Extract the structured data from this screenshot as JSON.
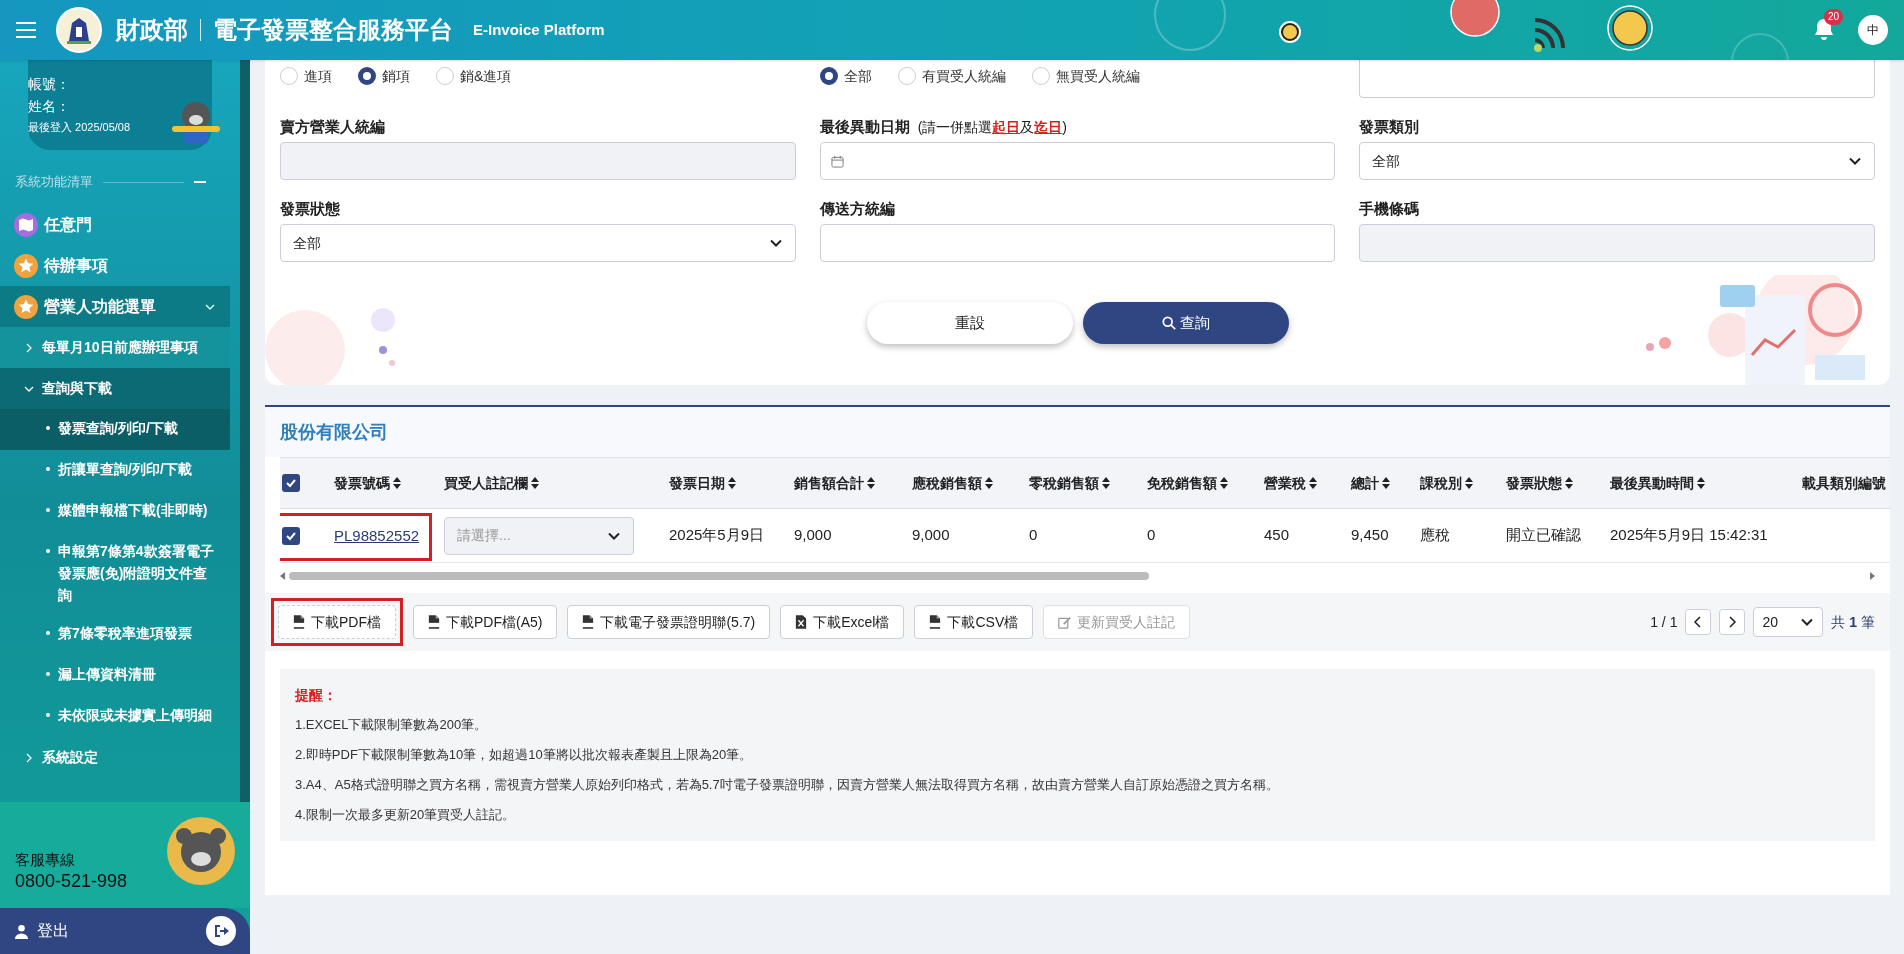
{
  "header": {
    "org": "財政部",
    "platform": "電子發票整合服務平台",
    "subtitle": "E-Invoice Platform",
    "notification_count": "20",
    "language": "中"
  },
  "user": {
    "account_label": "帳號：",
    "name_label": "姓名：",
    "last_login": "最後登入 2025/05/08"
  },
  "sidebar": {
    "section_title": "系統功能清單",
    "section_expanded": true,
    "items": [
      {
        "label": "任意門",
        "selected": false
      },
      {
        "label": "待辦事項",
        "selected": false
      },
      {
        "label": "營業人功能選單",
        "selected": false,
        "expanded": true,
        "children": [
          {
            "label": "每單月10日前應辦理事項",
            "selected": false,
            "expanded": false
          },
          {
            "label": "查詢與下載",
            "selected": false,
            "expanded": true,
            "children": [
              {
                "label": "發票查詢/列印/下載",
                "selected": true
              },
              {
                "label": "折讓單查詢/列印/下載",
                "selected": false
              },
              {
                "label": "媒體申報檔下載(非即時)",
                "selected": false
              },
              {
                "label": "申報第7條第4款簽署電子發票應(免)附證明文件查詢",
                "selected": false
              },
              {
                "label": "第7條零稅率進項發票",
                "selected": false
              },
              {
                "label": "漏上傳資料清冊",
                "selected": false
              },
              {
                "label": "未依限或未據實上傳明細",
                "selected": false
              }
            ]
          },
          {
            "label": "系統設定",
            "selected": false,
            "expanded": false
          }
        ]
      }
    ]
  },
  "support": {
    "label": "客服專線",
    "phone": "0800-521-998"
  },
  "logout": "登出",
  "search_form": {
    "rows": [
      [
        {
          "kind": "radio",
          "options": [
            {
              "label": "進項",
              "selected": false
            },
            {
              "label": "銷項",
              "selected": true
            },
            {
              "label": "銷&進項",
              "selected": false
            }
          ]
        },
        {
          "kind": "radio",
          "options": [
            {
              "label": "全部",
              "selected": true
            },
            {
              "label": "有買受人統編",
              "selected": false
            },
            {
              "label": "無買受人統編",
              "selected": false
            }
          ]
        },
        {
          "kind": "text",
          "disabled": false
        }
      ],
      [
        {
          "kind": "text",
          "label": "賣方營業人統編",
          "disabled": true
        },
        {
          "kind": "date",
          "label": "最後異動日期",
          "hint": "(請一併點選**起日**及**迄日**)",
          "disabled": false
        },
        {
          "kind": "select",
          "label": "發票類別",
          "value": "全部",
          "disabled": false
        }
      ],
      [
        {
          "kind": "select",
          "label": "發票狀態",
          "value": "全部",
          "disabled": false
        },
        {
          "kind": "text",
          "label": "傳送方統編",
          "disabled": false
        },
        {
          "kind": "text",
          "label": "手機條碼",
          "disabled": true
        }
      ]
    ],
    "reset_button": "重設",
    "search_button": "查詢"
  },
  "results": {
    "title": "股份有限公司",
    "all_checked": true,
    "columns": [
      {
        "label": "發票號碼",
        "sortable": true
      },
      {
        "label": "買受人註記欄",
        "sortable": true
      },
      {
        "label": "發票日期",
        "sortable": true
      },
      {
        "label": "銷售額合計",
        "sortable": true
      },
      {
        "label": "應稅銷售額",
        "sortable": true
      },
      {
        "label": "零稅銷售額",
        "sortable": true
      },
      {
        "label": "免稅銷售額",
        "sortable": true
      },
      {
        "label": "營業稅",
        "sortable": true
      },
      {
        "label": "總計",
        "sortable": true
      },
      {
        "label": "課稅別",
        "sortable": true
      },
      {
        "label": "發票狀態",
        "sortable": true
      },
      {
        "label": "最後異動時間",
        "sortable": true
      },
      {
        "label": "載具類別編號"
      }
    ],
    "rows": [
      {
        "checked": true,
        "highlighted": true,
        "invoice_number": "PL98852552",
        "buyer_note_placeholder": "請選擇...",
        "values": [
          "2025年5月9日",
          "9,000",
          "9,000",
          "0",
          "0",
          "450",
          "9,450",
          "應稅",
          "開立已確認",
          "2025年5月9日 15:42:31"
        ]
      }
    ],
    "actions": [
      {
        "kind": "pdf",
        "label": "下載PDF檔",
        "disabled": false,
        "highlighted": true
      },
      {
        "kind": "pdf",
        "label": "下載PDF檔(A5)",
        "disabled": false,
        "highlighted": false
      },
      {
        "kind": "pdf",
        "label": "下載電子發票證明聯(5.7)",
        "disabled": false,
        "highlighted": false
      },
      {
        "kind": "excel",
        "label": "下載Excel檔",
        "disabled": false,
        "highlighted": false
      },
      {
        "kind": "csv",
        "label": "下載CSV檔",
        "disabled": false,
        "highlighted": false
      },
      {
        "kind": "edit",
        "label": "更新買受人註記",
        "disabled": true,
        "highlighted": false
      }
    ],
    "pagination": {
      "page": "1 / 1",
      "page_size": "20",
      "total": "共 **1** 筆"
    }
  },
  "notes": {
    "title": "提醒：",
    "items": [
      "1.EXCEL下載限制筆數為200筆。",
      "2.即時PDF下載限制筆數為10筆，如超過10筆將以批次報表產製且上限為20筆。",
      "3.A4、A5格式證明聯之買方名稱，需視賣方營業人原始列印格式，若為5.7吋電子發票證明聯，因賣方營業人無法取得買方名稱，故由賣方營業人自訂原始憑證之買方名稱。",
      "4.限制一次最多更新20筆買受人註記。"
    ]
  }
}
